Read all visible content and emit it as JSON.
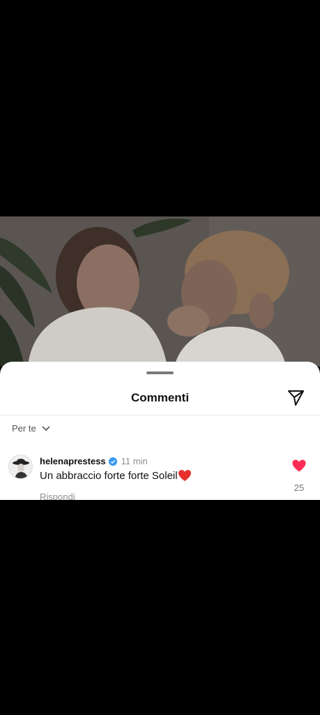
{
  "sheet": {
    "title": "Commenti",
    "send_icon": "paper-plane-icon"
  },
  "filter": {
    "label": "Per te",
    "chevron_icon": "chevron-down-icon"
  },
  "comment": {
    "username": "helenaprestess",
    "verified": true,
    "time": "11 min",
    "text": "Un abbraccio forte forte Soleil",
    "text_emoji": "heart-emoji",
    "reply_label": "Rispondi",
    "like_icon": "heart-icon",
    "like_color": "#ff2d55",
    "like_count": "25"
  },
  "colors": {
    "verified_badge": "#3897f0",
    "backdrop": "#000000"
  }
}
